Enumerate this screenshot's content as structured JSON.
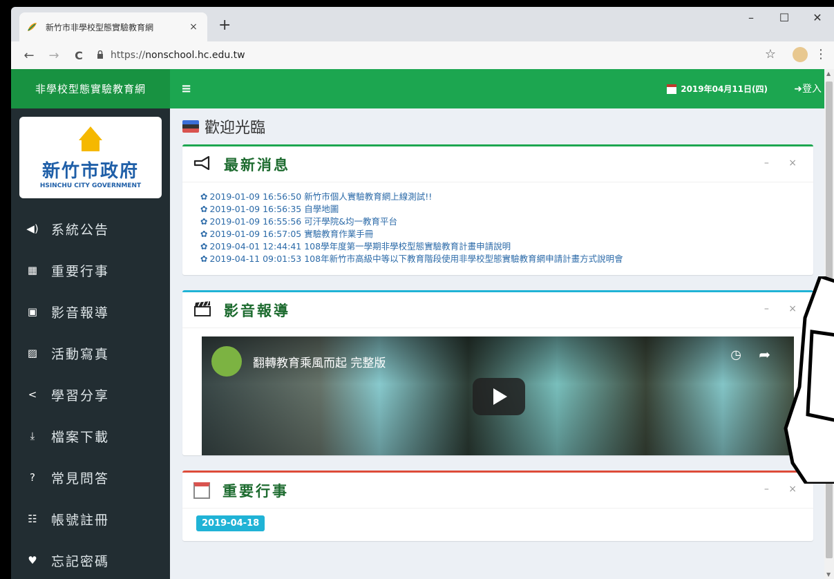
{
  "browser": {
    "tab_title": "新竹市非學校型態實驗教育網",
    "tab_close": "×",
    "new_tab": "+",
    "minimize": "–",
    "maximize": "☐",
    "close": "✕",
    "url_scheme": "https://",
    "url_host": "nonschool.hc.edu.tw",
    "back": "←",
    "forward": "→",
    "reload": "C",
    "star": "☆",
    "menu": "⋮"
  },
  "topbar": {
    "brand": "非學校型態實驗教育網",
    "hamburger": "≡",
    "date": "2019年04月11日(四)",
    "login": "➜登入"
  },
  "logo": {
    "name_cn": "新竹市政府",
    "name_en": "HSINCHU CITY GOVERNMENT"
  },
  "sidebar": {
    "items": [
      {
        "icon": "◀)",
        "label": "系統公告"
      },
      {
        "icon": "▦",
        "label": "重要行事"
      },
      {
        "icon": "▣",
        "label": "影音報導"
      },
      {
        "icon": "▨",
        "label": "活動寫真"
      },
      {
        "icon": "<",
        "label": "學習分享"
      },
      {
        "icon": "⤓",
        "label": "檔案下載"
      },
      {
        "icon": "?",
        "label": "常見問答"
      },
      {
        "icon": "☷",
        "label": "帳號註冊"
      },
      {
        "icon": "♥",
        "label": "忘記密碼"
      }
    ]
  },
  "main": {
    "welcome": "歡迎光臨",
    "news": {
      "title": "最新消息",
      "tools": "– ×",
      "items": [
        "2019-01-09 16:56:50 新竹市個人實驗教育網上線測試!!",
        "2019-01-09 16:56:35 自學地圖",
        "2019-01-09 16:55:56 可汗學院&均一教育平台",
        "2019-01-09 16:57:05 實驗教育作業手冊",
        "2019-04-01 12:44:41 108學年度第一學期非學校型態實驗教育計畫申請說明",
        "2019-04-11 09:01:53 108年新竹市高級中等以下教育階段使用非學校型態實驗教育網申請計畫方式說明會"
      ]
    },
    "video": {
      "title": "影音報導",
      "tools": "– ×",
      "video_title": "翻轉教育乘風而起 完整版"
    },
    "events": {
      "title": "重要行事",
      "tools": "– ×",
      "first_date": "2019-04-18"
    }
  }
}
